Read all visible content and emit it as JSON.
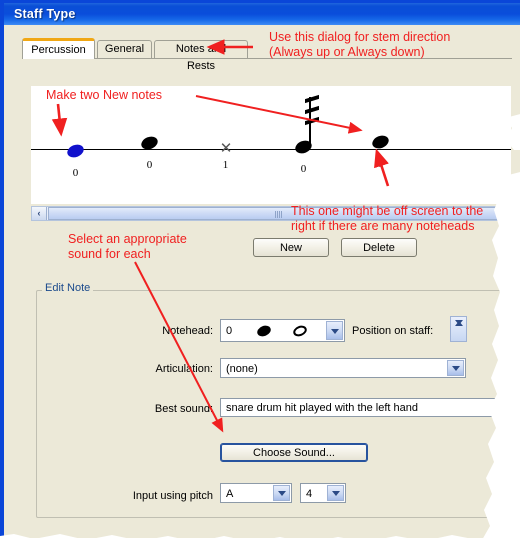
{
  "window": {
    "title": "Staff Type"
  },
  "tabs": [
    {
      "label": "Percussion",
      "active": true
    },
    {
      "label": "General",
      "active": false
    },
    {
      "label": "Notes and Rests",
      "active": false
    }
  ],
  "notehead_preview": {
    "items": [
      {
        "glyph": "oval-filled",
        "color": "#1111cc",
        "number": "0"
      },
      {
        "glyph": "oval-filled",
        "color": "#000000",
        "number": "0"
      },
      {
        "glyph": "x-notehead",
        "color": "#555555",
        "number": "1"
      },
      {
        "glyph": "oval-filled-with-flags",
        "color": "#000000",
        "number": "0"
      },
      {
        "glyph": "oval-filled",
        "color": "#000000",
        "number": "0"
      }
    ],
    "scrollbar": {
      "left_arrow": "‹",
      "name": "horizontal-scrollbar"
    }
  },
  "buttons": {
    "new": "New",
    "delete": "Delete",
    "choose_sound": "Choose Sound..."
  },
  "edit_note": {
    "group_title": "Edit Note",
    "notehead_label": "Notehead:",
    "notehead_value": "0",
    "position_on_staff_label": "Position on staff:",
    "position_on_staff_value": "",
    "articulation_label": "Articulation:",
    "articulation_value": "(none)",
    "best_sound_label": "Best sound:",
    "best_sound_value": "snare drum hit played with the left hand",
    "input_using_pitch_label": "Input using pitch",
    "pitch_letter": "A",
    "pitch_octave": "4"
  },
  "annotations": [
    {
      "name": "ann-stem-direction",
      "text": "Use this dialog for stem direction\n(Always up or Always down)"
    },
    {
      "name": "ann-make-two-new-notes",
      "text": "Make two New notes"
    },
    {
      "name": "ann-off-screen-right",
      "text": "This one might be off screen to the\nright if there are many noteheads"
    },
    {
      "name": "ann-select-sound",
      "text": "Select an appropriate\nsound for each"
    }
  ],
  "colors": {
    "titlebar_blue": "#0a4dd6",
    "dialog_face": "#ece9d8",
    "annotation_red": "#f02020",
    "group_title_blue": "#1b4a8c",
    "active_tab_accent": "#f0a714",
    "blue_notehead": "#1111cc"
  }
}
